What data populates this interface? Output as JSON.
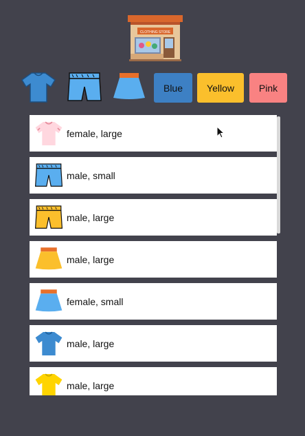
{
  "header": {
    "logo_icon": "clothing-store-icon",
    "store_sign": "CLOTHING STORE"
  },
  "filters": {
    "type_icons": [
      "tshirt-icon",
      "shorts-icon",
      "skirt-icon"
    ],
    "color_buttons": [
      {
        "label": "Blue",
        "color": "#3d80c4"
      },
      {
        "label": "Yellow",
        "color": "#fbbf2c"
      },
      {
        "label": "Pink",
        "color": "#f98282"
      }
    ]
  },
  "items": [
    {
      "icon": "tshirt-icon",
      "color": "#ffd7df",
      "label": "female, large"
    },
    {
      "icon": "shorts-icon",
      "color": "#5aaeef",
      "label": "male, small"
    },
    {
      "icon": "shorts-icon",
      "color": "#fbbf2c",
      "label": "male, large"
    },
    {
      "icon": "skirt-icon",
      "color": "#fbbf2c",
      "label": "male, large"
    },
    {
      "icon": "skirt-icon",
      "color": "#5aaeef",
      "label": "female, small"
    },
    {
      "icon": "tshirt-icon",
      "color": "#3d8bd0",
      "label": "male, large"
    },
    {
      "icon": "tshirt-icon",
      "color": "#ffd400",
      "label": "male, large"
    }
  ]
}
